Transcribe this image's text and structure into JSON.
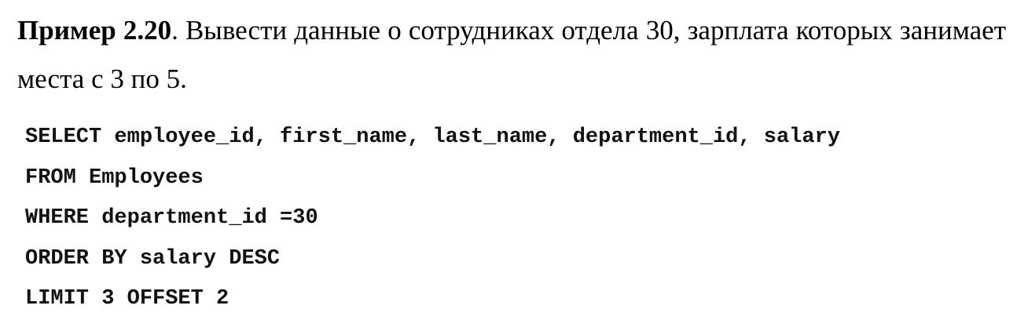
{
  "example": {
    "label": "Пример 2.20",
    "text": ". Вывести данные о сотрудниках отдела 30, зарплата которых занимает места с 3 по 5."
  },
  "code": {
    "lines": [
      "SELECT employee_id, first_name, last_name, department_id, salary",
      "FROM Employees",
      "WHERE department_id =30",
      "ORDER BY salary DESC",
      "LIMIT 3 OFFSET 2"
    ]
  }
}
